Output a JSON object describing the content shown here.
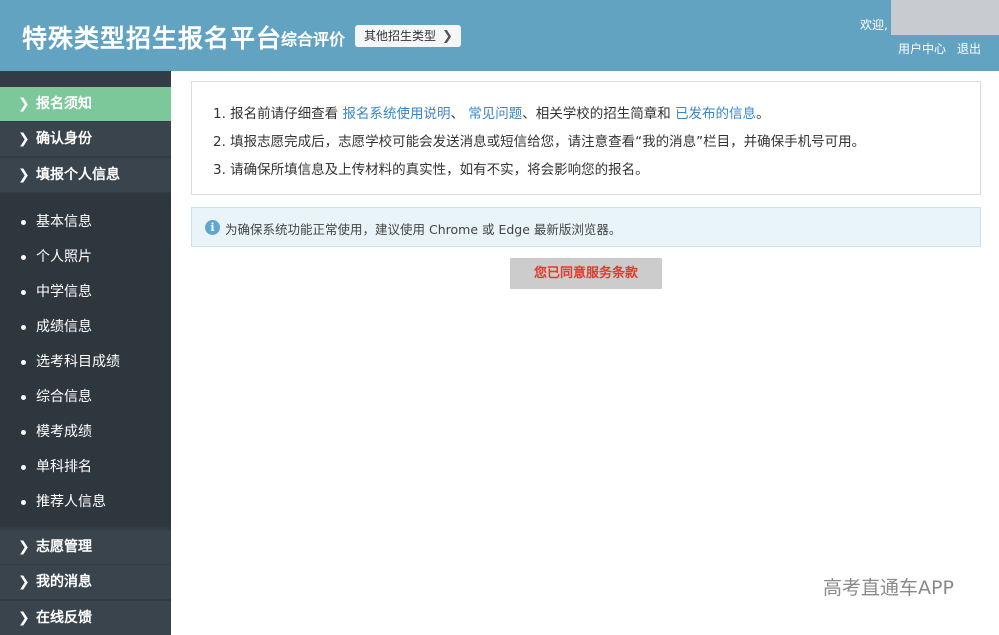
{
  "header": {
    "title": "特殊类型招生报名平台",
    "section": "综合评价",
    "other_types_label": "其他招生类型",
    "welcome": "欢迎,",
    "user_center": "用户中心",
    "logout": "退出"
  },
  "sidebar": {
    "items": [
      {
        "label": "报名须知"
      },
      {
        "label": "确认身份"
      },
      {
        "label": "填报个人信息"
      },
      {
        "label": "志愿管理"
      },
      {
        "label": "我的消息"
      },
      {
        "label": "在线反馈"
      }
    ],
    "subitems": [
      {
        "label": "基本信息"
      },
      {
        "label": "个人照片"
      },
      {
        "label": "中学信息"
      },
      {
        "label": "成绩信息"
      },
      {
        "label": "选考科目成绩"
      },
      {
        "label": "综合信息"
      },
      {
        "label": "模考成绩"
      },
      {
        "label": "单科排名"
      },
      {
        "label": "推荐人信息"
      }
    ]
  },
  "notice": {
    "line1": {
      "prefix": "1. 报名前请仔细查看 ",
      "link1": "报名系统使用说明",
      "sep": "、 ",
      "link2": "常见问题",
      "middle": "、相关学校的招生简章和 ",
      "link3": "已发布的信息",
      "suffix": "。"
    },
    "line2": "2. 填报志愿完成后，志愿学校可能会发送消息或短信给您，请注意查看“我的消息”栏目，并确保手机号可用。",
    "line3": "3. 请确保所填信息及上传材料的真实性，如有不实，将会影响您的报名。"
  },
  "tip": {
    "icon": "i",
    "text": "为确保系统功能正常使用，建议使用 Chrome 或 Edge 最新版浏览器。"
  },
  "agree_button": "您已同意服务条款",
  "watermark": "高考直通车APP"
}
